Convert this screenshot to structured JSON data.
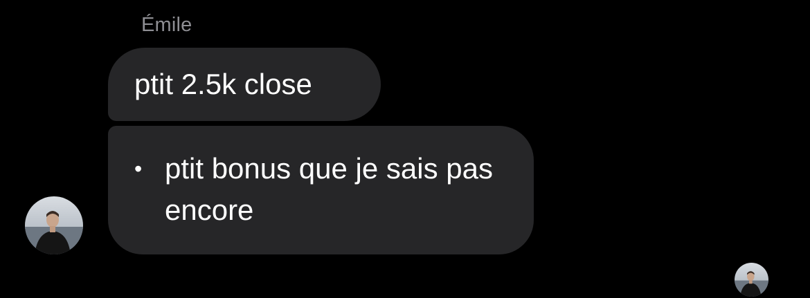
{
  "conversation": {
    "sender_name": "Émile",
    "messages": [
      {
        "text": "ptit 2.5k close"
      },
      {
        "bullet": "•",
        "text": "ptit bonus que je sais pas encore"
      }
    ],
    "avatar_icon": "profile-photo-icon",
    "read_receipt_icon": "read-receipt-avatar-icon"
  },
  "colors": {
    "background": "#000000",
    "bubble": "#262628",
    "sender_name": "#8e8e93",
    "text": "#ffffff"
  }
}
